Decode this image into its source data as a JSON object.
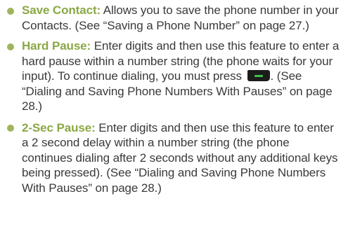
{
  "items": [
    {
      "term": "Save Contact:",
      "text": " Allows you to save the phone number in your Contacts. (See “Saving a Phone Number” on page 27.)"
    },
    {
      "term": "Hard Pause:",
      "text_before": " Enter digits and then use this feature to enter a hard pause within a number string (the phone waits for your input). To continue dialing, you must press ",
      "key_icon": "send-key-icon",
      "text_after": ". (See “Dialing and Saving Phone Numbers With Pauses” on page 28.)"
    },
    {
      "term": "2-Sec Pause:",
      "text": " Enter digits and then use this feature to enter a 2 second delay within a number string (the phone continues dialing after 2 seconds without any additional keys being pressed). (See “Dialing and Saving Phone Numbers With Pauses” on page 28.)"
    }
  ],
  "colors": {
    "bullet": "#9fb55a",
    "term": "#8aa844",
    "body_text": "#3a3a3a",
    "send_key": "#1c1c1c",
    "send_key_glyph": "#3fc24a"
  }
}
